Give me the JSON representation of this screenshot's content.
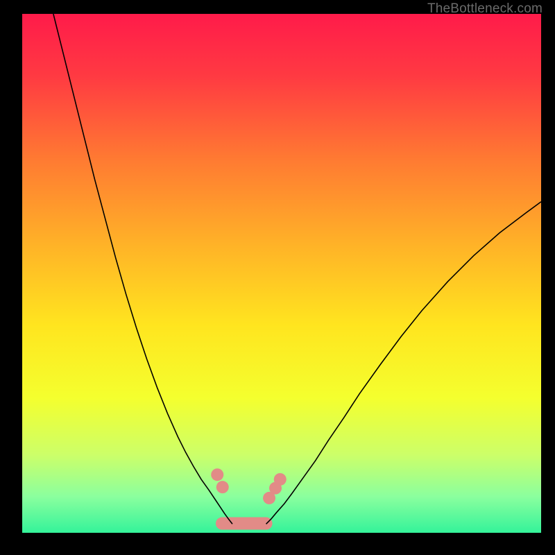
{
  "watermark": "TheBottleneck.com",
  "chart_data": {
    "type": "line",
    "title": "",
    "xlabel": "",
    "ylabel": "",
    "xlim": [
      0,
      100
    ],
    "ylim": [
      0,
      100
    ],
    "grid": false,
    "legend": false,
    "background": {
      "type": "vertical-gradient",
      "stops": [
        {
          "pos": 0.0,
          "color": "#ff1b4a"
        },
        {
          "pos": 0.12,
          "color": "#ff3a42"
        },
        {
          "pos": 0.28,
          "color": "#ff7a32"
        },
        {
          "pos": 0.45,
          "color": "#ffb427"
        },
        {
          "pos": 0.6,
          "color": "#ffe51f"
        },
        {
          "pos": 0.74,
          "color": "#f4ff2e"
        },
        {
          "pos": 0.85,
          "color": "#ccff69"
        },
        {
          "pos": 0.93,
          "color": "#8bff9e"
        },
        {
          "pos": 1.0,
          "color": "#34f39a"
        }
      ]
    },
    "series": [
      {
        "name": "curve-left",
        "stroke": "#000000",
        "width": 1.6,
        "x": [
          6,
          8,
          10,
          12,
          14,
          16,
          18,
          20,
          22,
          24,
          26,
          28,
          30,
          31.5,
          33,
          34.5,
          36,
          37.2,
          38.2,
          39,
          39.8,
          40.5
        ],
        "y": [
          100,
          92,
          84,
          76,
          68,
          60.5,
          53,
          46,
          39.5,
          33.5,
          28,
          23,
          18.5,
          15.5,
          12.8,
          10.3,
          8.2,
          6.4,
          4.9,
          3.7,
          2.6,
          1.7
        ]
      },
      {
        "name": "curve-right",
        "stroke": "#000000",
        "width": 1.6,
        "x": [
          47,
          48,
          49,
          50.5,
          52,
          54,
          56.5,
          59,
          62,
          65,
          69,
          73,
          77,
          82,
          87,
          92,
          97,
          100
        ],
        "y": [
          1.7,
          2.7,
          3.9,
          5.6,
          7.6,
          10.4,
          13.9,
          17.8,
          22.2,
          26.8,
          32.4,
          37.8,
          42.8,
          48.4,
          53.4,
          57.8,
          61.6,
          63.8
        ]
      }
    ],
    "markers": {
      "name": "highlight-band",
      "fill": "#e28b87",
      "stroke": "#e28b87",
      "radius": 9,
      "capsule_height": 18,
      "points_left": [
        {
          "x": 37.6,
          "y": 11.2
        },
        {
          "x": 38.6,
          "y": 8.8
        }
      ],
      "points_right": [
        {
          "x": 47.6,
          "y": 6.7
        },
        {
          "x": 48.8,
          "y": 8.6
        },
        {
          "x": 49.7,
          "y": 10.3
        }
      ],
      "bottom_capsule": {
        "x0": 38.5,
        "x1": 47.0,
        "y": 1.8
      }
    }
  }
}
